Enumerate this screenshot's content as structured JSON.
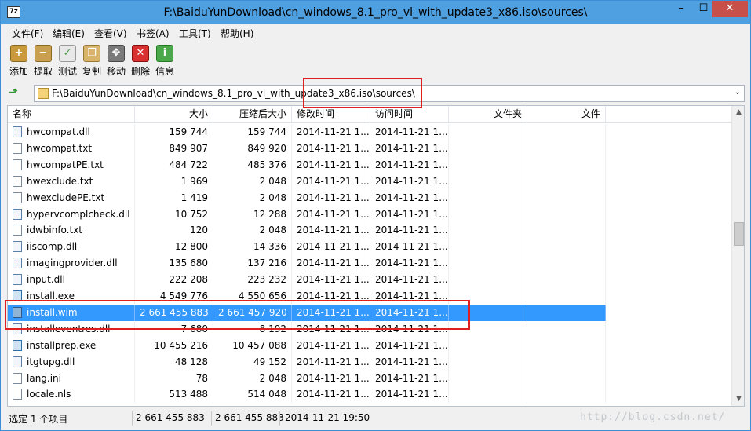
{
  "window": {
    "app_icon_text": "7z",
    "title": "F:\\BaiduYunDownload\\cn_windows_8.1_pro_vl_with_update3_x86.iso\\sources\\",
    "controls": {
      "minimize": "–",
      "maximize": "☐",
      "close": "✕"
    }
  },
  "menu": [
    {
      "label": "文件(F)"
    },
    {
      "label": "编辑(E)"
    },
    {
      "label": "查看(V)"
    },
    {
      "label": "书签(A)"
    },
    {
      "label": "工具(T)"
    },
    {
      "label": "帮助(H)"
    }
  ],
  "toolbar": [
    {
      "label": "添加",
      "icon": "add-icon"
    },
    {
      "label": "提取",
      "icon": "extract-icon"
    },
    {
      "label": "测试",
      "icon": "test-icon"
    },
    {
      "label": "复制",
      "icon": "copy-icon"
    },
    {
      "label": "移动",
      "icon": "move-icon"
    },
    {
      "label": "删除",
      "icon": "delete-icon"
    },
    {
      "label": "信息",
      "icon": "info-icon"
    }
  ],
  "address": {
    "path": "F:\\BaiduYunDownload\\cn_windows_8.1_pro_vl_with_update3_x86.iso\\sources\\"
  },
  "columns": {
    "name": "名称",
    "size": "大小",
    "packed": "压缩后大小",
    "modified": "修改时间",
    "accessed": "访问时间",
    "folders": "文件夹",
    "files": "文件"
  },
  "rows": [
    {
      "name": "hwcompat.dll",
      "size": "159 744",
      "packed": "159 744",
      "modified": "2014-11-21 1...",
      "accessed": "2014-11-21 1...",
      "type": "dll"
    },
    {
      "name": "hwcompat.txt",
      "size": "849 907",
      "packed": "849 920",
      "modified": "2014-11-21 1...",
      "accessed": "2014-11-21 1...",
      "type": "txt"
    },
    {
      "name": "hwcompatPE.txt",
      "size": "484 722",
      "packed": "485 376",
      "modified": "2014-11-21 1...",
      "accessed": "2014-11-21 1...",
      "type": "txt"
    },
    {
      "name": "hwexclude.txt",
      "size": "1 969",
      "packed": "2 048",
      "modified": "2014-11-21 1...",
      "accessed": "2014-11-21 1...",
      "type": "txt"
    },
    {
      "name": "hwexcludePE.txt",
      "size": "1 419",
      "packed": "2 048",
      "modified": "2014-11-21 1...",
      "accessed": "2014-11-21 1...",
      "type": "txt"
    },
    {
      "name": "hypervcomplcheck.dll",
      "size": "10 752",
      "packed": "12 288",
      "modified": "2014-11-21 1...",
      "accessed": "2014-11-21 1...",
      "type": "dll"
    },
    {
      "name": "idwbinfo.txt",
      "size": "120",
      "packed": "2 048",
      "modified": "2014-11-21 1...",
      "accessed": "2014-11-21 1...",
      "type": "txt"
    },
    {
      "name": "iiscomp.dll",
      "size": "12 800",
      "packed": "14 336",
      "modified": "2014-11-21 1...",
      "accessed": "2014-11-21 1...",
      "type": "dll"
    },
    {
      "name": "imagingprovider.dll",
      "size": "135 680",
      "packed": "137 216",
      "modified": "2014-11-21 1...",
      "accessed": "2014-11-21 1...",
      "type": "dll"
    },
    {
      "name": "input.dll",
      "size": "222 208",
      "packed": "223 232",
      "modified": "2014-11-21 1...",
      "accessed": "2014-11-21 1...",
      "type": "dll"
    },
    {
      "name": "install.exe",
      "size": "4 549 776",
      "packed": "4 550 656",
      "modified": "2014-11-21 1...",
      "accessed": "2014-11-21 1...",
      "type": "exe"
    },
    {
      "name": "install.wim",
      "size": "2 661 455 883",
      "packed": "2 661 457 920",
      "modified": "2014-11-21 1...",
      "accessed": "2014-11-21 1...",
      "type": "wim",
      "selected": true
    },
    {
      "name": "installeventres.dll",
      "size": "7 680",
      "packed": "8 192",
      "modified": "2014-11-21 1...",
      "accessed": "2014-11-21 1...",
      "type": "dll"
    },
    {
      "name": "installprep.exe",
      "size": "10 455 216",
      "packed": "10 457 088",
      "modified": "2014-11-21 1...",
      "accessed": "2014-11-21 1...",
      "type": "exe"
    },
    {
      "name": "itgtupg.dll",
      "size": "48 128",
      "packed": "49 152",
      "modified": "2014-11-21 1...",
      "accessed": "2014-11-21 1...",
      "type": "dll"
    },
    {
      "name": "lang.ini",
      "size": "78",
      "packed": "2 048",
      "modified": "2014-11-21 1...",
      "accessed": "2014-11-21 1...",
      "type": "ini"
    },
    {
      "name": "locale.nls",
      "size": "513 488",
      "packed": "514 048",
      "modified": "2014-11-21 1...",
      "accessed": "2014-11-21 1...",
      "type": "nls"
    }
  ],
  "status": {
    "selection": "选定 1 个项目",
    "size": "2 661 455 883",
    "packed": "2 661 455 883",
    "date": "2014-11-21 19:50",
    "watermark": "http://blog.csdn.net/"
  }
}
